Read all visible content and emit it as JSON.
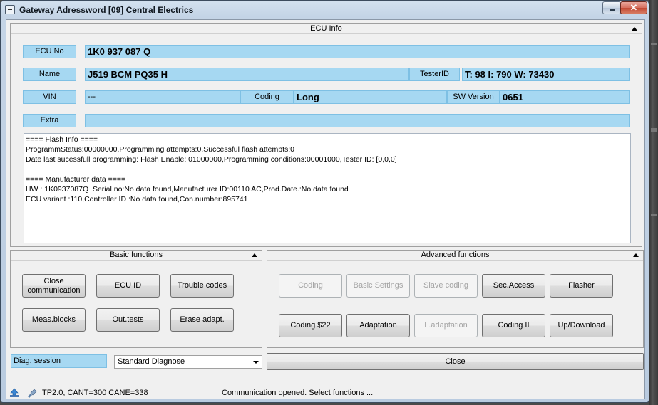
{
  "window": {
    "title": "Gateway Adressword [09] Central Electrics",
    "close_glyph": "✕"
  },
  "ecu_info": {
    "header": "ECU Info",
    "labels": {
      "ecu_no": "ECU No",
      "name": "Name",
      "vin": "VIN",
      "extra": "Extra",
      "tester_id": "TesterID",
      "coding": "Coding",
      "sw_version": "SW Version"
    },
    "values": {
      "ecu_no": "1K0 937 087 Q",
      "name": "J519 BCM PQ35  H",
      "tester_id": "T: 98 I: 790 W: 73430",
      "vin": "---",
      "coding": "Long",
      "sw_version": "0651",
      "extra": ""
    },
    "info_text": "==== Flash Info ====\nProgrammStatus:00000000,Programming attempts:0,Successful flash attempts:0\nDate last sucessfull programming: Flash Enable: 01000000,Programming conditions:00001000,Tester ID: [0,0,0]\n\n==== Manufacturer data ====\nHW : 1K0937087Q  Serial no:No data found,Manufacturer ID:00110 AC,Prod.Date.:No data found\nECU variant :110,Controller ID :No data found,Con.number:895741"
  },
  "basic_functions": {
    "header": "Basic functions",
    "buttons": [
      {
        "label": "Close communication",
        "enabled": true
      },
      {
        "label": "ECU ID",
        "enabled": true
      },
      {
        "label": "Trouble codes",
        "enabled": true
      },
      {
        "label": "Meas.blocks",
        "enabled": true
      },
      {
        "label": "Out.tests",
        "enabled": true
      },
      {
        "label": "Erase adapt.",
        "enabled": true
      }
    ]
  },
  "advanced_functions": {
    "header": "Advanced functions",
    "buttons": [
      {
        "label": "Coding",
        "enabled": false
      },
      {
        "label": "Basic Settings",
        "enabled": false
      },
      {
        "label": "Slave coding",
        "enabled": false
      },
      {
        "label": "Sec.Access",
        "enabled": true
      },
      {
        "label": "Flasher",
        "enabled": true
      },
      {
        "label": "Coding $22",
        "enabled": true
      },
      {
        "label": "Adaptation",
        "enabled": true
      },
      {
        "label": "L.adaptation",
        "enabled": false
      },
      {
        "label": "Coding II",
        "enabled": true
      },
      {
        "label": "Up/Download",
        "enabled": true
      }
    ]
  },
  "diag_session": {
    "label": "Diag. session",
    "selected": "Standard Diagnose"
  },
  "close_button": "Close",
  "status": {
    "protocol": "TP2.0, CANT=300 CANE=338",
    "message": "Communication opened. Select functions ..."
  }
}
